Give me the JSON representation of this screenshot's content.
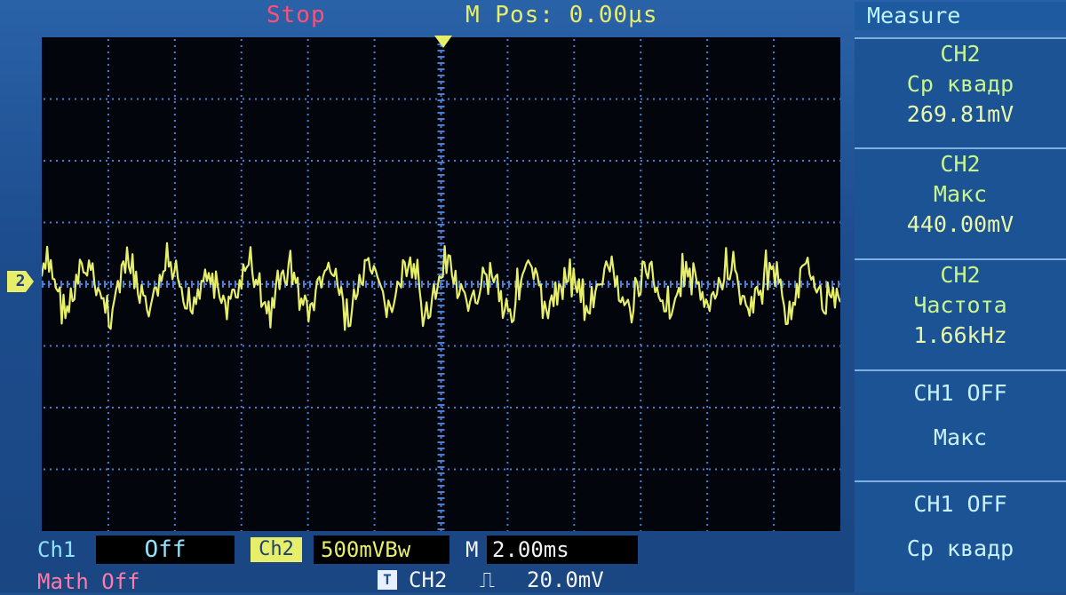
{
  "status": {
    "run_state": "Stop",
    "horizontal_position": "M Pos: 0.00µs"
  },
  "colors": {
    "background": "#1f4f8c",
    "screen": "#02050b",
    "grid": "#4a7fd0",
    "ch2_trace": "#e7ef6a",
    "stop_text": "#ff4f7a",
    "measure_value": "#c9f58f"
  },
  "measure": {
    "title": "Measure",
    "panels": [
      {
        "channel": "CH2",
        "type": "Ср квадр",
        "value": "269.81mV"
      },
      {
        "channel": "CH2",
        "type": "Макс",
        "value": "440.00mV"
      },
      {
        "channel": "CH2",
        "type": "Частота",
        "value": "1.66kHz"
      },
      {
        "channel": "CH1 OFF",
        "type": "Макс",
        "value": ""
      },
      {
        "channel": "CH1 OFF",
        "type": "Ср квадр",
        "value": ""
      }
    ]
  },
  "channels": {
    "ch1_label": "Ch1",
    "ch1_state": "Off",
    "ch2_label": "Ch2",
    "ch2_scale": "500mVBw",
    "math_label": "Math Off"
  },
  "timebase": {
    "label": "M",
    "value": "2.00ms"
  },
  "trigger": {
    "icon": "T",
    "source": "CH2",
    "edge": "rising-edge-icon",
    "edge_glyph": "⎍",
    "level": "20.0mV"
  },
  "ch2_marker": "2",
  "icons": {
    "trigger_position": "trigger-position-marker",
    "channel_marker": "ch2-ground-marker"
  }
}
